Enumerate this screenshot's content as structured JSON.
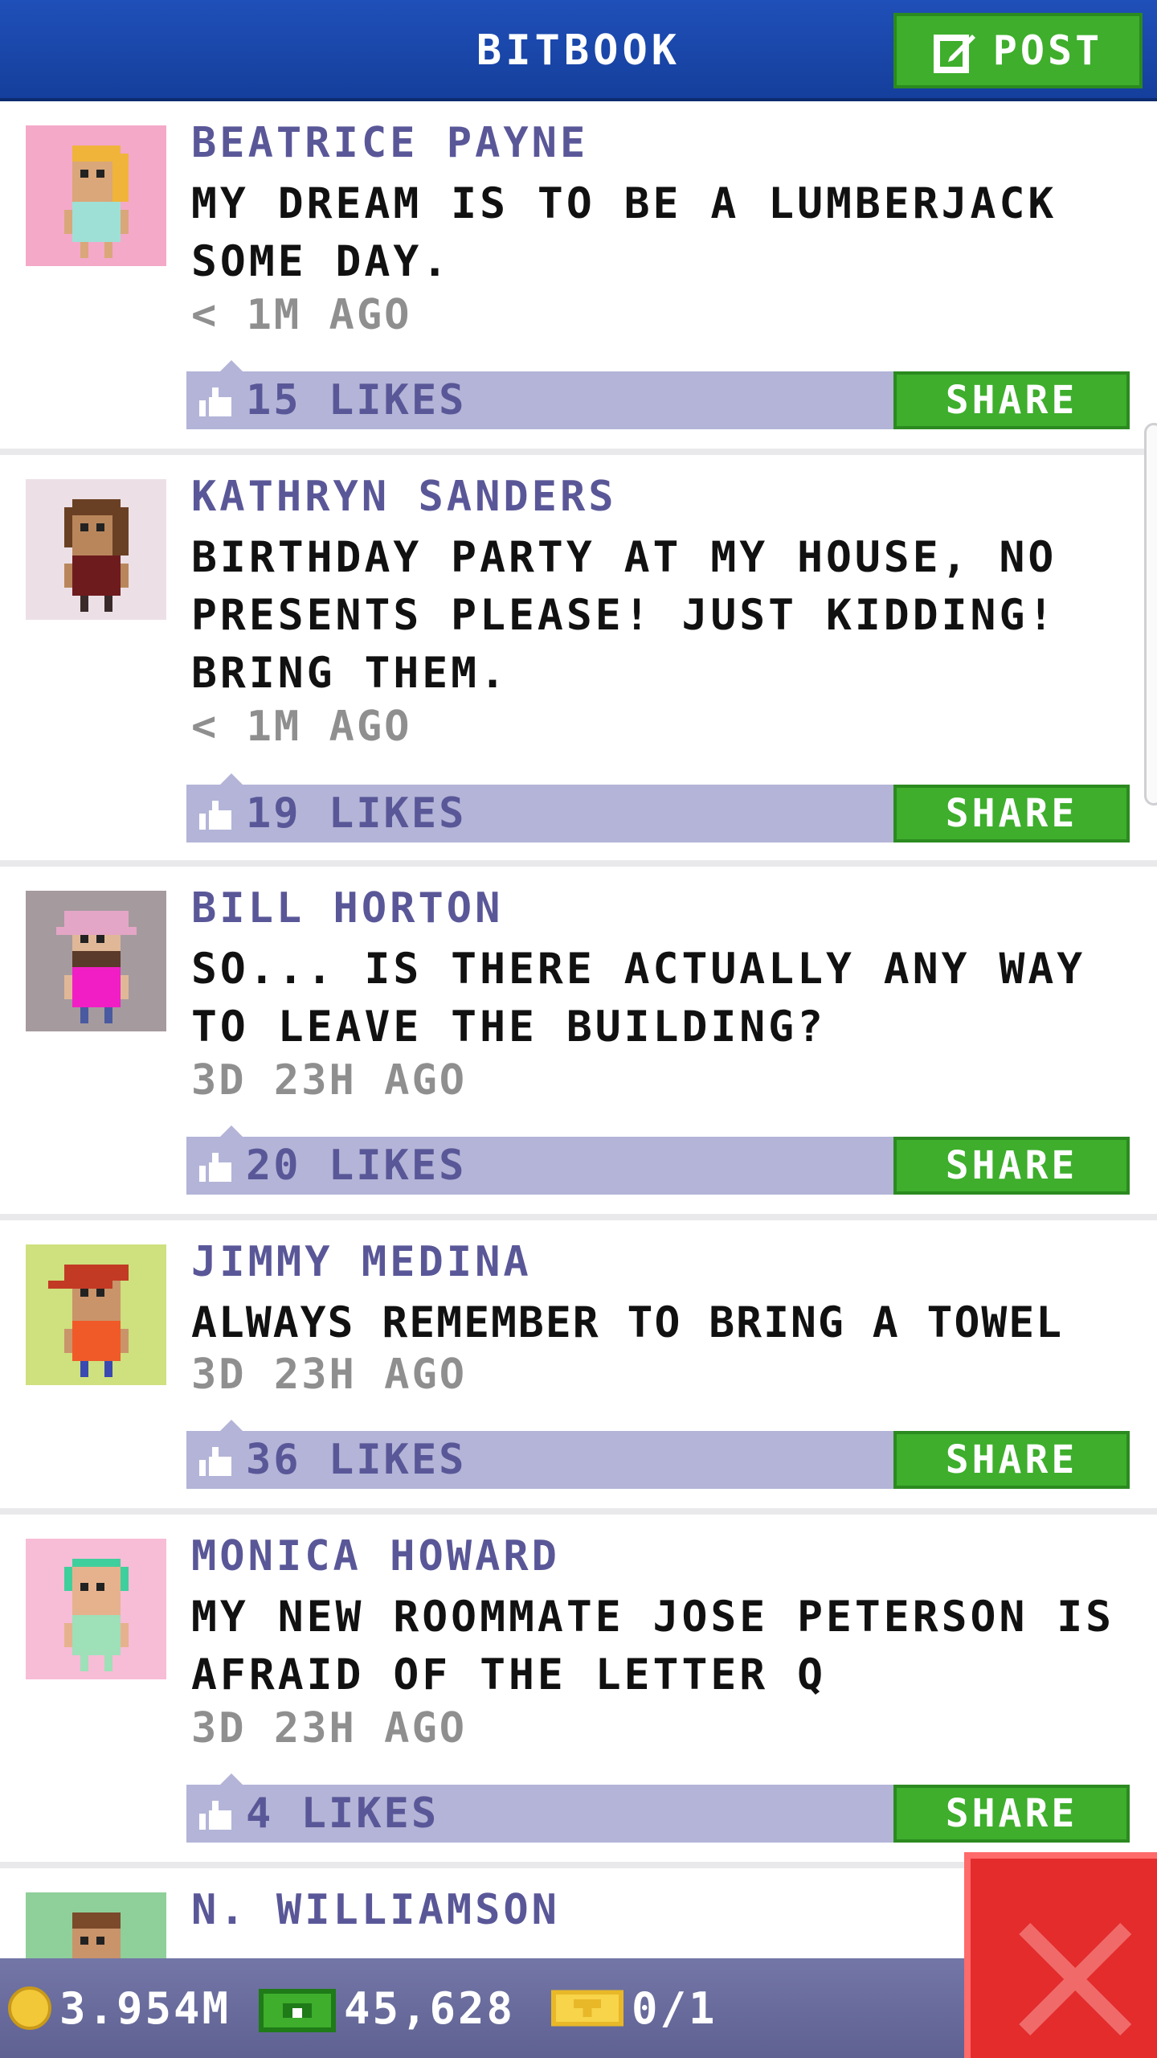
{
  "header": {
    "title": "BITBOOK",
    "post_label": "POST"
  },
  "posts": [
    {
      "author": "BEATRICE PAYNE",
      "message": "MY DREAM IS TO BE A LUMBERJACK SOME DAY.",
      "time": "< 1M AGO",
      "likes": "15 LIKES",
      "share_label": "SHARE",
      "avatar_bg": "#f4a9c9",
      "skin": "#d9a77a",
      "hair": "#f0b43a",
      "shirt": "#9ee0d6",
      "pants": "#9ee0d6"
    },
    {
      "author": "KATHRYN SANDERS",
      "message": "BIRTHDAY PARTY AT MY HOUSE, NO PRESENTS PLEASE! JUST KIDDING! BRING THEM.",
      "time": "< 1M AGO",
      "likes": "19 LIKES",
      "share_label": "SHARE",
      "avatar_bg": "#ece0e6",
      "skin": "#b9865c",
      "hair": "#6a4024",
      "shirt": "#6e1b1e",
      "pants": "#3a2a2a"
    },
    {
      "author": "BILL HORTON",
      "message": "SO... IS THERE ACTUALLY ANY WAY TO LEAVE THE BUILDING?",
      "time": "3D 23H AGO",
      "likes": "20 LIKES",
      "share_label": "SHARE",
      "avatar_bg": "#a59a9e",
      "skin": "#e0b898",
      "hair": "#e4a6c6",
      "shirt": "#f01ec4",
      "pants": "#4a5aa0"
    },
    {
      "author": "JIMMY MEDINA",
      "message": "ALWAYS REMEMBER TO BRING A TOWEL",
      "time": "3D 23H AGO",
      "likes": "36 LIKES",
      "share_label": "SHARE",
      "avatar_bg": "#cfe07e",
      "skin": "#c9946a",
      "hair": "#c23a24",
      "shirt": "#f05a28",
      "pants": "#3a4ab0"
    },
    {
      "author": "MONICA HOWARD",
      "message": "MY NEW ROOMMATE JOSE PETERSON IS AFRAID OF THE LETTER Q",
      "time": "3D 23H AGO",
      "likes": "4 LIKES",
      "share_label": "SHARE",
      "avatar_bg": "#f7bcd6",
      "skin": "#e6b28e",
      "hair": "#3fcf9c",
      "shirt": "#9ee0b8",
      "pants": "#9ee0b8"
    },
    {
      "author": "N. WILLIAMSON",
      "avatar_bg": "#8fcf9a",
      "skin": "#c9946a",
      "hair": "#7a4a2a",
      "shirt": "#3e8ae0",
      "pants": "#2a2a5a"
    }
  ],
  "footer": {
    "coins": "3.954M",
    "bux": "45,628",
    "tickets": "0/1"
  }
}
